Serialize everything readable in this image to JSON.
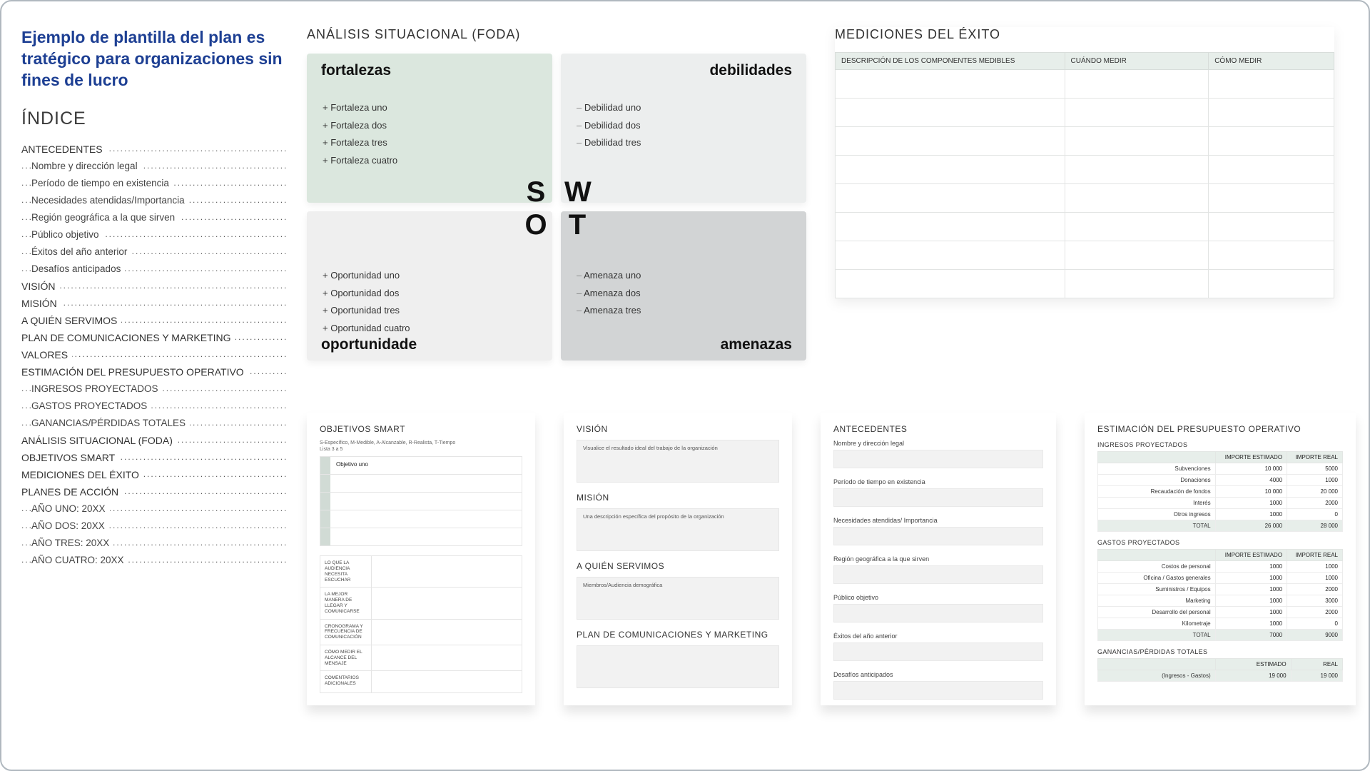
{
  "title": "Ejemplo de plantilla del plan es tratégico para organizaciones sin fines de lucro",
  "index_heading": "ÍNDICE",
  "toc": [
    {
      "t": "ANTECEDENTES",
      "l": 0
    },
    {
      "t": "Nombre y dirección legal",
      "l": 1
    },
    {
      "t": "Período de tiempo en existencia",
      "l": 1
    },
    {
      "t": "Necesidades atendidas/Importancia",
      "l": 1
    },
    {
      "t": "Región geográfica a la que sirven",
      "l": 1
    },
    {
      "t": "Público objetivo",
      "l": 1
    },
    {
      "t": "Éxitos del año anterior",
      "l": 1
    },
    {
      "t": "Desafíos anticipados",
      "l": 1
    },
    {
      "t": "VISIÓN",
      "l": 0
    },
    {
      "t": "MISIÓN",
      "l": 0
    },
    {
      "t": "A QUIÉN SERVIMOS",
      "l": 0
    },
    {
      "t": "PLAN DE COMUNICACIONES Y MARKETING",
      "l": 0
    },
    {
      "t": "VALORES",
      "l": 0
    },
    {
      "t": "ESTIMACIÓN DEL PRESUPUESTO OPERATIVO",
      "l": 0
    },
    {
      "t": "INGRESOS PROYECTADOS",
      "l": 1
    },
    {
      "t": "GASTOS PROYECTADOS",
      "l": 1
    },
    {
      "t": "GANANCIAS/PÉRDIDAS TOTALES",
      "l": 1
    },
    {
      "t": "ANÁLISIS SITUACIONAL (FODA)",
      "l": 0
    },
    {
      "t": "OBJETIVOS SMART",
      "l": 0
    },
    {
      "t": "MEDICIONES DEL ÉXITO",
      "l": 0
    },
    {
      "t": "PLANES DE ACCIÓN",
      "l": 0
    },
    {
      "t": "AÑO UNO: 20XX",
      "l": 1
    },
    {
      "t": "AÑO DOS: 20XX",
      "l": 1
    },
    {
      "t": "AÑO TRES: 20XX",
      "l": 1
    },
    {
      "t": "AÑO CUATRO: 20XX",
      "l": 1
    }
  ],
  "swot": {
    "heading": "ANÁLISIS SITUACIONAL (FODA)",
    "letters": [
      "S",
      "W",
      "O",
      "T"
    ],
    "s": {
      "title": "fortalezas",
      "items": [
        "Fortaleza uno",
        "Fortaleza dos",
        "Fortaleza tres",
        "Fortaleza cuatro"
      ]
    },
    "w": {
      "title": "debilidades",
      "items": [
        "Debilidad uno",
        "Debilidad dos",
        "Debilidad tres"
      ]
    },
    "o": {
      "title": "oportunidade",
      "items": [
        "Oportunidad uno",
        "Oportunidad dos",
        "Oportunidad tres",
        "Oportunidad cuatro"
      ]
    },
    "t": {
      "title": "amenazas",
      "items": [
        "Amenaza uno",
        "Amenaza dos",
        "Amenaza tres"
      ]
    }
  },
  "measures": {
    "heading": "MEDICIONES DEL ÉXITO",
    "cols": [
      "DESCRIPCIÓN DE LOS COMPONENTES MEDIBLES",
      "CUÁNDO MEDIR",
      "CÓMO MEDIR"
    ],
    "rows": 8
  },
  "objectives": {
    "heading": "OBJETIVOS SMART",
    "subheading": "S-Específico, M-Medible, A-Alcanzable, R-Realista, T-Tiempo",
    "listhint": "Lista 3 a 5",
    "first": "Objetivo uno",
    "matrix": [
      "LO QUE LA AUDIENCIA NECESITA ESCUCHAR",
      "LA MEJOR MANERA DE LLEGAR Y COMUNICARSE",
      "CRONOGRAMA Y FRECUENCIA DE COMUNICACIÓN",
      "CÓMO MEDIR EL ALCANCE DEL MENSAJE",
      "COMENTARIOS ADICIONALES"
    ]
  },
  "vision_thumb": {
    "vision_h": "VISIÓN",
    "vision_txt": "Visualice el resultado ideal del trabajo de la organización",
    "mision_h": "MISIÓN",
    "mision_txt": "Una descripción específica del propósito de la organización",
    "serve_h": "A QUIÉN SERVIMOS",
    "serve_txt": "Miembros/Audiencia demográfica",
    "plan_h": "PLAN DE COMUNICACIONES Y MARKETING"
  },
  "antecedentes": {
    "heading": "ANTECEDENTES",
    "fields": [
      "Nombre y dirección legal",
      "Período de tiempo en existencia",
      "Necesidades atendidas/ Importancia",
      "Región geográfica a la que sirven",
      "Público objetivo",
      "Éxitos del año anterior",
      "Desafíos anticipados"
    ]
  },
  "budget": {
    "heading": "ESTIMACIÓN DEL PRESUPUESTO OPERATIVO",
    "col_est": "IMPORTE ESTIMADO",
    "col_real": "IMPORTE REAL",
    "income_h": "INGRESOS PROYECTADOS",
    "income": [
      {
        "l": "Subvenciones",
        "e": "10 000",
        "r": "5000"
      },
      {
        "l": "Donaciones",
        "e": "4000",
        "r": "1000"
      },
      {
        "l": "Recaudación de fondos",
        "e": "10 000",
        "r": "20 000"
      },
      {
        "l": "Interés",
        "e": "1000",
        "r": "2000"
      },
      {
        "l": "Otros ingresos",
        "e": "1000",
        "r": "0"
      }
    ],
    "income_total": {
      "l": "TOTAL",
      "e": "26 000",
      "r": "28 000"
    },
    "expense_h": "GASTOS PROYECTADOS",
    "expense": [
      {
        "l": "Costos de personal",
        "e": "1000",
        "r": "1000"
      },
      {
        "l": "Oficina / Gastos generales",
        "e": "1000",
        "r": "1000"
      },
      {
        "l": "Suministros / Equipos",
        "e": "1000",
        "r": "2000"
      },
      {
        "l": "Marketing",
        "e": "1000",
        "r": "3000"
      },
      {
        "l": "Desarrollo del personal",
        "e": "1000",
        "r": "2000"
      },
      {
        "l": "Kilometraje",
        "e": "1000",
        "r": "0"
      }
    ],
    "expense_total": {
      "l": "TOTAL",
      "e": "7000",
      "r": "9000"
    },
    "gp_h": "GANANCIAS/PÉRDIDAS TOTALES",
    "gp_col_est": "ESTIMADO",
    "gp_col_real": "REAL",
    "gp_row": {
      "l": "(Ingresos - Gastos)",
      "e": "19 000",
      "r": "19 000"
    }
  }
}
